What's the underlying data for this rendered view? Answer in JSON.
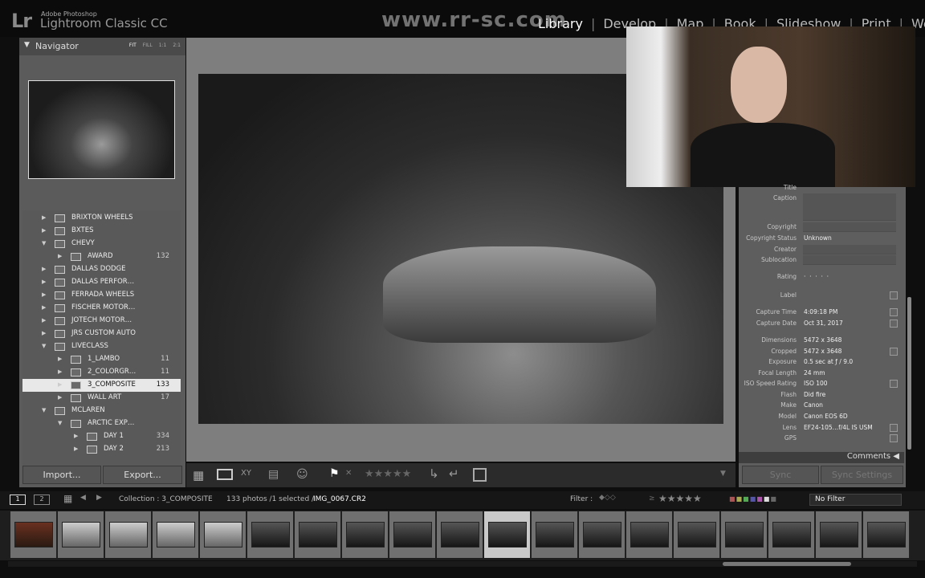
{
  "app": {
    "logo": "Lr",
    "brand_small": "Adobe Photoshop",
    "brand_big": "Lightroom Classic CC"
  },
  "watermark": "www.rr-sc.com",
  "modules": [
    "Library",
    "Develop",
    "Map",
    "Book",
    "Slideshow",
    "Print",
    "Web"
  ],
  "active_module": "Library",
  "navigator": {
    "title": "Navigator",
    "zoom": [
      "FIT",
      "FILL",
      "1:1",
      "2:1"
    ],
    "active_zoom": "FIT"
  },
  "folders": [
    {
      "label": "BRIXTON WHEELS",
      "level": 0,
      "expanded": false
    },
    {
      "label": "BXTES",
      "level": 0,
      "expanded": false
    },
    {
      "label": "CHEVY",
      "level": 0,
      "expanded": true
    },
    {
      "label": "AWARD",
      "level": 1,
      "count": "132"
    },
    {
      "label": "DALLAS DODGE",
      "level": 0,
      "expanded": false
    },
    {
      "label": "DALLAS PERFOR…",
      "level": 0,
      "expanded": false
    },
    {
      "label": "FERRADA WHEELS",
      "level": 0,
      "expanded": false
    },
    {
      "label": "FISCHER MOTOR…",
      "level": 0,
      "expanded": false
    },
    {
      "label": "JOTECH MOTOR…",
      "level": 0,
      "expanded": false
    },
    {
      "label": "JRS CUSTOM AUTO",
      "level": 0,
      "expanded": false
    },
    {
      "label": "LIVECLASS",
      "level": 0,
      "expanded": true
    },
    {
      "label": "1_LAMBO",
      "level": 1,
      "count": "11"
    },
    {
      "label": "2_COLORGR…",
      "level": 1,
      "count": "11"
    },
    {
      "label": "3_COMPOSITE",
      "level": 1,
      "count": "133",
      "selected": true
    },
    {
      "label": "WALL ART",
      "level": 1,
      "count": "17"
    },
    {
      "label": "MCLAREN",
      "level": 0,
      "expanded": true
    },
    {
      "label": "ARCTIC EXP…",
      "level": 1,
      "expanded": true
    },
    {
      "label": "DAY 1",
      "level": 2,
      "count": "334"
    },
    {
      "label": "DAY 2",
      "level": 2,
      "count": "213"
    }
  ],
  "buttons": {
    "import": "Import...",
    "export": "Export...",
    "sync": "Sync",
    "sync_settings": "Sync Settings"
  },
  "metadata": {
    "title_label": "Title",
    "caption_label": "Caption",
    "copyright_label": "Copyright",
    "copyright_status_label": "Copyright Status",
    "copyright_status": "Unknown",
    "creator_label": "Creator",
    "sublocation_label": "Sublocation",
    "rating_label": "Rating",
    "rating": 0,
    "label_label": "Label",
    "rows": [
      {
        "k": "Capture Time",
        "v": "4:09:18 PM"
      },
      {
        "k": "Capture Date",
        "v": "Oct 31, 2017"
      },
      {
        "k": "Dimensions",
        "v": "5472 x 3648"
      },
      {
        "k": "Cropped",
        "v": "5472 x 3648"
      },
      {
        "k": "Exposure",
        "v": "0.5 sec at ƒ / 9.0"
      },
      {
        "k": "Focal Length",
        "v": "24 mm"
      },
      {
        "k": "ISO Speed Rating",
        "v": "ISO 100"
      },
      {
        "k": "Flash",
        "v": "Did fire"
      },
      {
        "k": "Make",
        "v": "Canon"
      },
      {
        "k": "Model",
        "v": "Canon EOS 6D"
      },
      {
        "k": "Lens",
        "v": "EF24-105…f/4L IS USM"
      },
      {
        "k": "GPS",
        "v": ""
      }
    ],
    "comments": "Comments"
  },
  "filmbar": {
    "screen1": "1",
    "screen2": "2",
    "collection": "Collection : 3_COMPOSITE",
    "count": "133 photos /1 selected /",
    "filename": "IMG_0067.CR2",
    "filter_label": "Filter :",
    "filter_value": "No Filter",
    "rating_op": "≥"
  },
  "filmstrip": {
    "count": 19,
    "selected_index": 10
  }
}
